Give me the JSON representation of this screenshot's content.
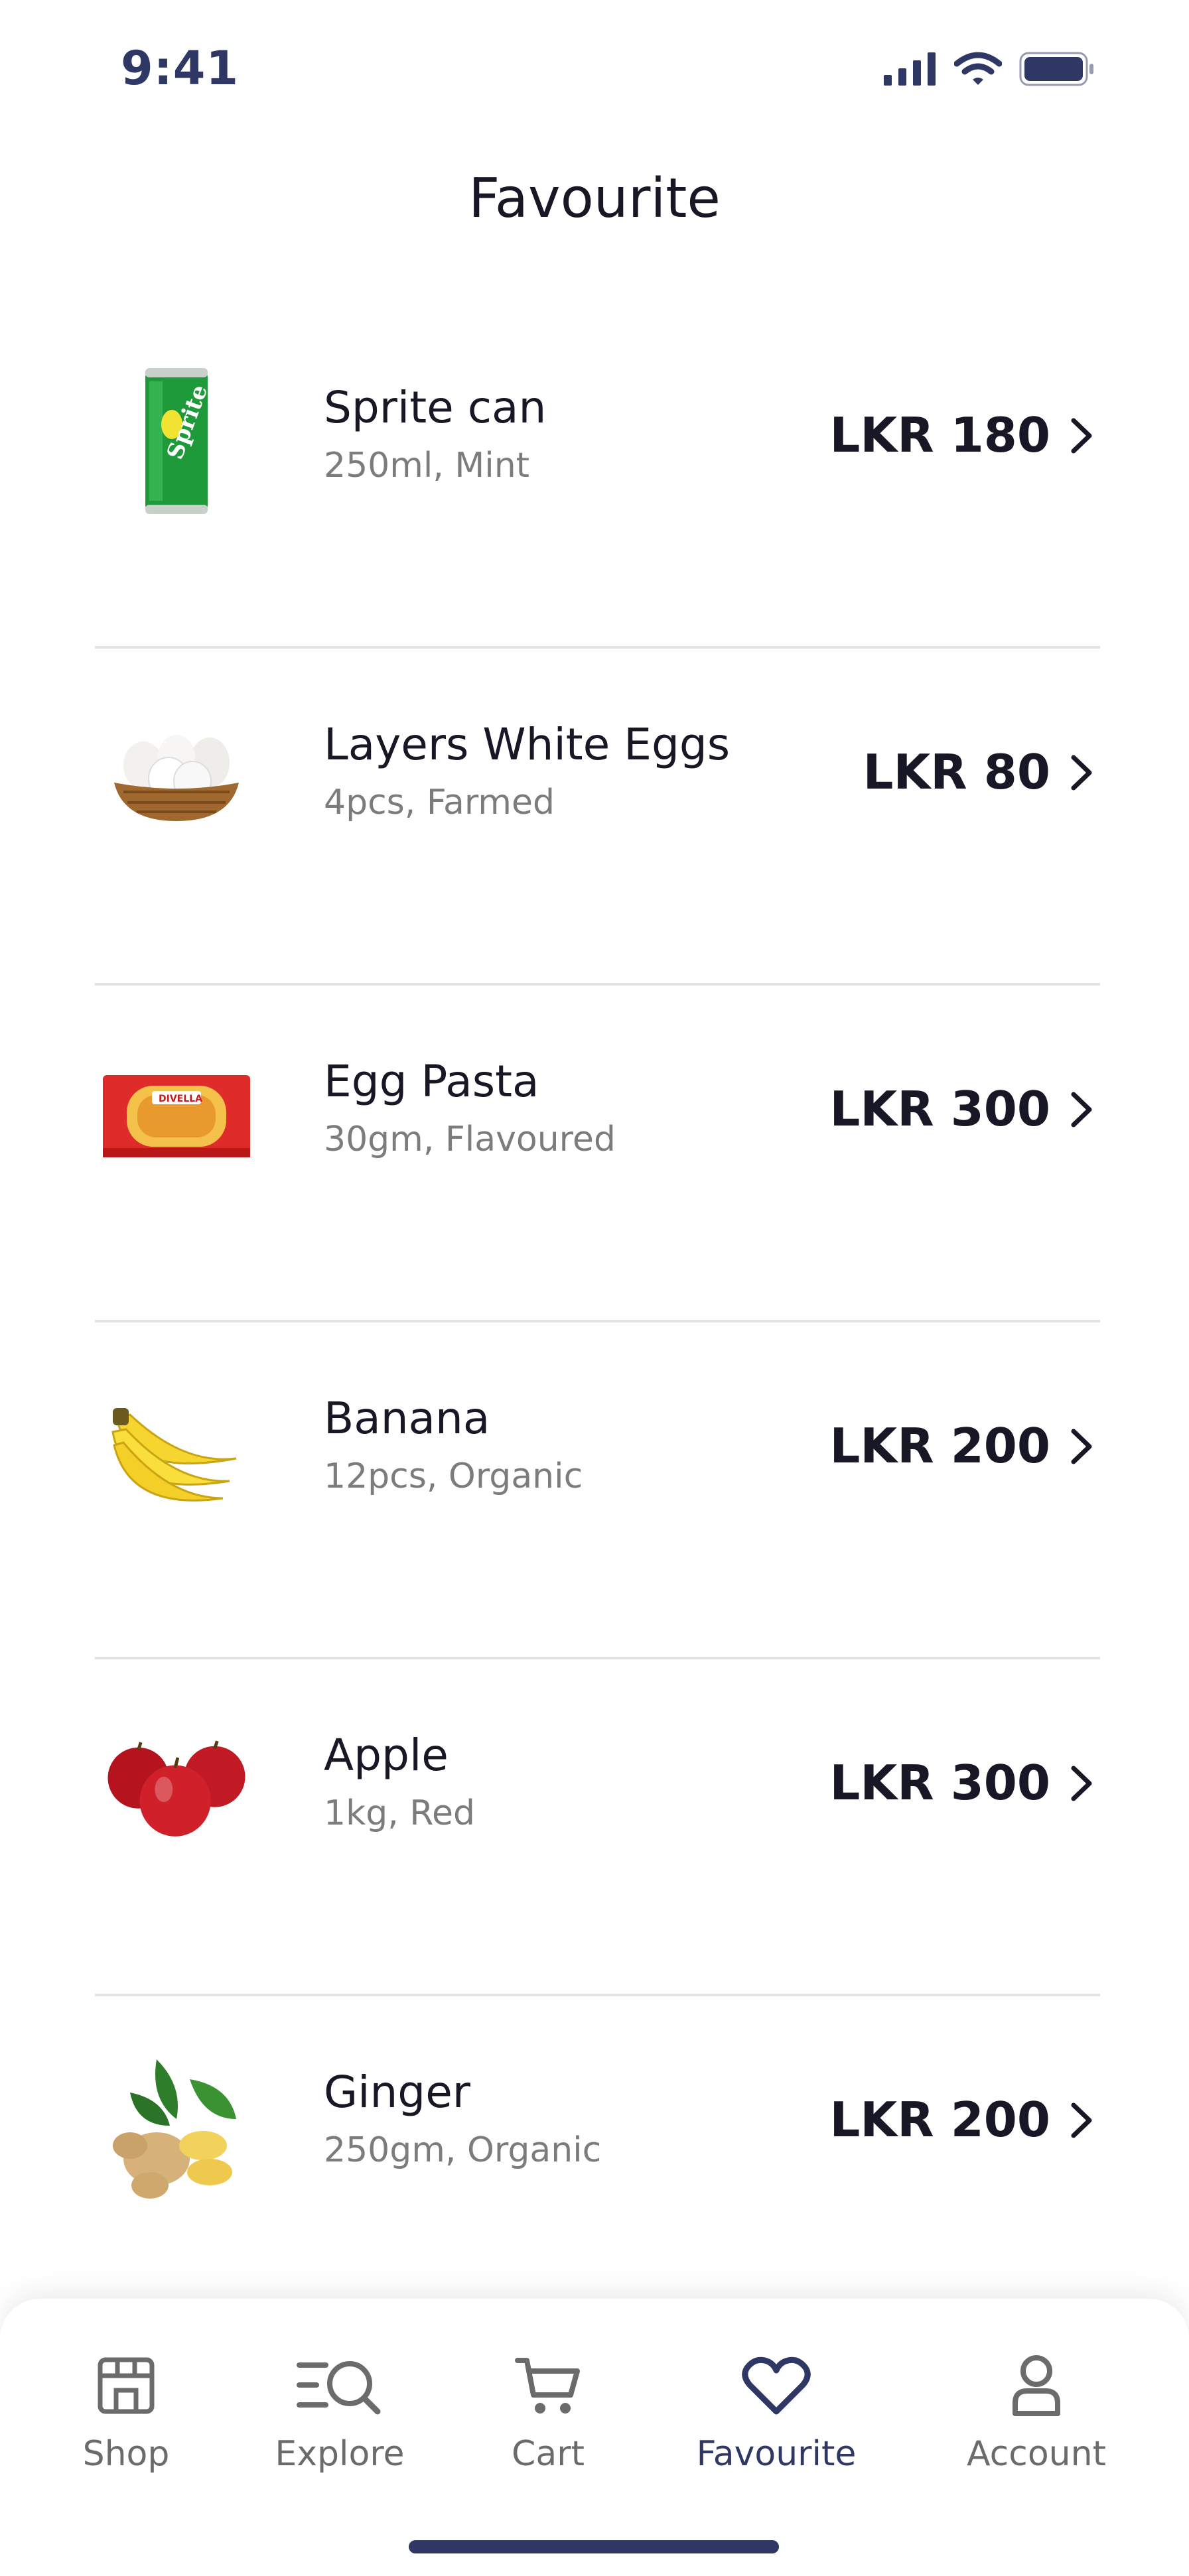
{
  "status_bar": {
    "time": "9:41"
  },
  "header": {
    "title": "Favourite"
  },
  "items": [
    {
      "name": "Sprite can",
      "detail": "250ml, Mint",
      "price": "LKR 180",
      "image": "sprite-can-image"
    },
    {
      "name": "Layers White Eggs",
      "detail": "4pcs, Farmed",
      "price": "LKR 80",
      "image": "eggs-basket-image"
    },
    {
      "name": "Egg Pasta",
      "detail": "30gm, Flavoured",
      "price": "LKR 300",
      "image": "pasta-pack-image"
    },
    {
      "name": "Banana",
      "detail": "12pcs, Organic",
      "price": "LKR 200",
      "image": "banana-image"
    },
    {
      "name": "Apple",
      "detail": "1kg, Red",
      "price": "LKR 300",
      "image": "apple-image"
    },
    {
      "name": "Ginger",
      "detail": "250gm, Organic",
      "price": "LKR 200",
      "image": "ginger-image"
    }
  ],
  "nav": {
    "tabs": [
      {
        "label": "Shop",
        "icon": "store-icon"
      },
      {
        "label": "Explore",
        "icon": "explore-icon"
      },
      {
        "label": "Cart",
        "icon": "cart-icon"
      },
      {
        "label": "Favourite",
        "icon": "heart-icon",
        "active": true
      },
      {
        "label": "Account",
        "icon": "user-icon"
      }
    ]
  },
  "colors": {
    "accent": "#2F3865",
    "text": "#181725",
    "muted": "#7C7C7C",
    "divider": "#E2E2E2"
  }
}
